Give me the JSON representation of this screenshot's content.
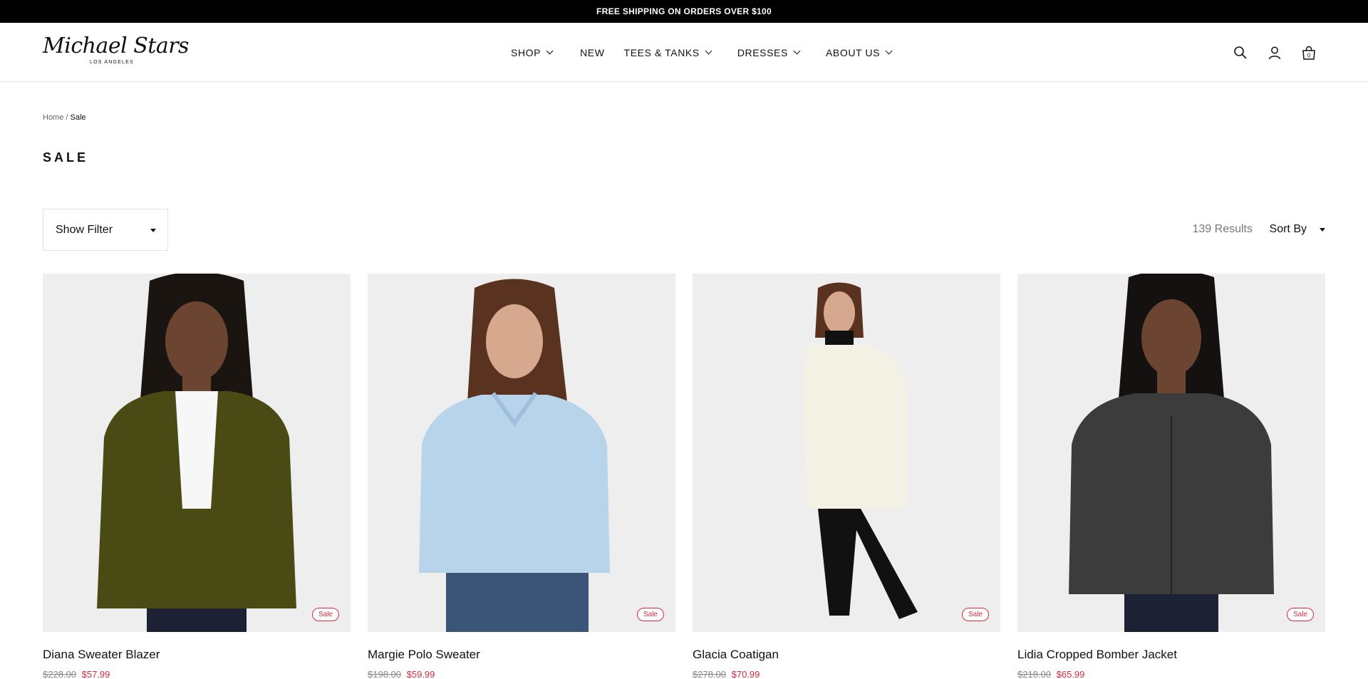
{
  "announcement": "FREE SHIPPING ON ORDERS OVER $100",
  "brand": {
    "name": "Michael Stars",
    "tagline": "LOS ANGELES"
  },
  "nav": [
    {
      "label": "SHOP",
      "dropdown": true
    },
    {
      "label": "NEW",
      "dropdown": false
    },
    {
      "label": "TEES & TANKS",
      "dropdown": true
    },
    {
      "label": "DRESSES",
      "dropdown": true
    },
    {
      "label": "ABOUT US",
      "dropdown": true
    }
  ],
  "header_icons": [
    "search-icon",
    "account-icon",
    "cart-icon"
  ],
  "cart": {
    "count": "0"
  },
  "breadcrumb": {
    "home": "Home",
    "separator": "/",
    "current": "Sale"
  },
  "page_title": "SALE",
  "filter": {
    "label": "Show Filter"
  },
  "results": {
    "count": "139 Results"
  },
  "sort": {
    "label": "Sort By"
  },
  "colors": {
    "sale_red": "#d52b3c",
    "photo_bg": "#eeeeee"
  },
  "products": [
    {
      "name": "Diana Sweater Blazer",
      "badge": "Sale",
      "price_original": "$228.00",
      "price_sale": "$57.99",
      "garment_color": "#4a4a14"
    },
    {
      "name": "Margie Polo Sweater",
      "badge": "Sale",
      "price_original": "$198.00",
      "price_sale": "$59.99",
      "garment_color": "#b8d4ea"
    },
    {
      "name": "Glacia Coatigan",
      "badge": "Sale",
      "price_original": "$278.00",
      "price_sale": "$70.99",
      "garment_color": "#f3f0e4"
    },
    {
      "name": "Lidia Cropped Bomber Jacket",
      "badge": "Sale",
      "price_original": "$218.00",
      "price_sale": "$65.99",
      "garment_color": "#3c3c3c"
    }
  ]
}
